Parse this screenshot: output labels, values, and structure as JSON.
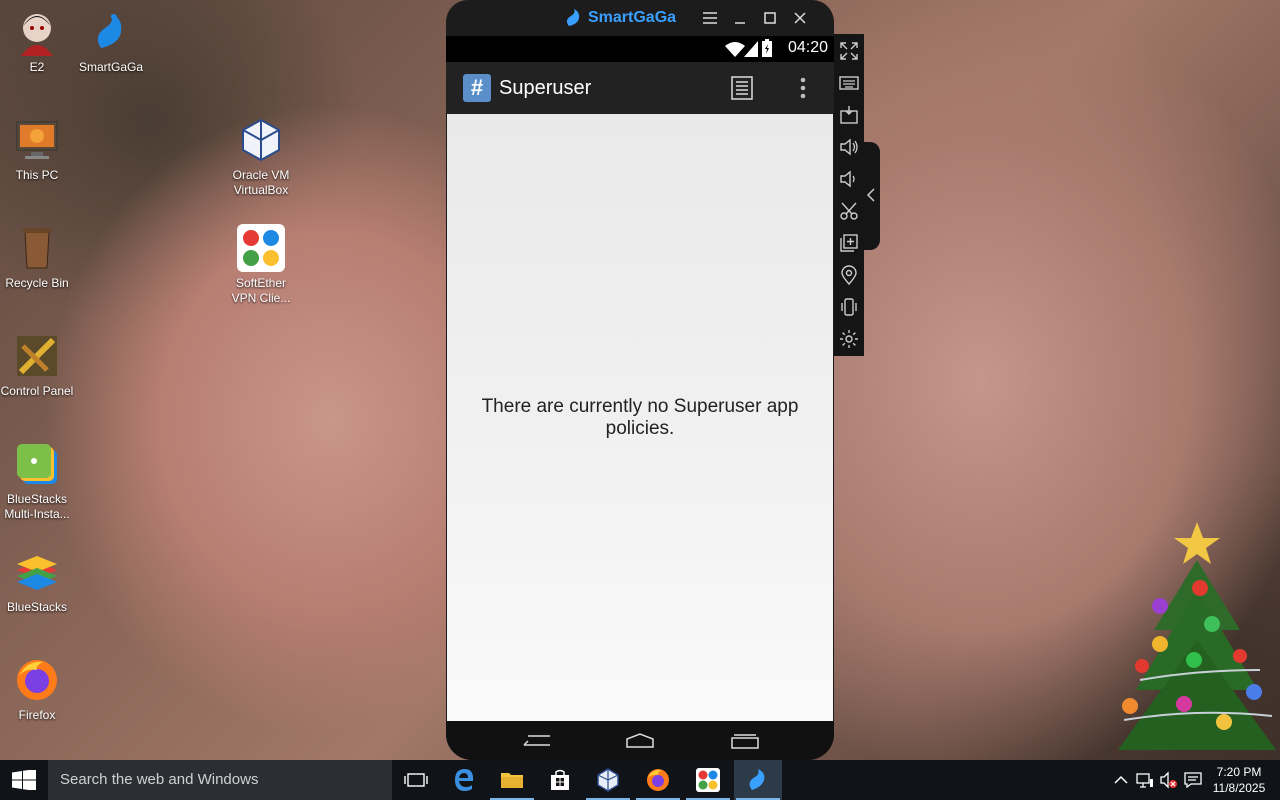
{
  "desktop": {
    "icons": [
      {
        "label": "E2"
      },
      {
        "label": "SmartGaGa"
      },
      {
        "label": "This PC"
      },
      {
        "label": "Oracle VM VirtualBox"
      },
      {
        "label": "Recycle Bin"
      },
      {
        "label": "SoftEther VPN Clie..."
      },
      {
        "label": "Control Panel"
      },
      {
        "label": "BlueStacks Multi-Insta..."
      },
      {
        "label": "BlueStacks"
      },
      {
        "label": "Firefox"
      }
    ]
  },
  "emulator": {
    "brand": "SmartGaGa",
    "window_controls": [
      "menu-icon",
      "minimize-icon",
      "maximize-icon",
      "close-icon"
    ],
    "status_bar": {
      "time": "04:20"
    },
    "app_bar": {
      "title": "Superuser",
      "icon": "hash-icon"
    },
    "screen": {
      "message": "There are currently no Superuser app policies."
    },
    "side_toolbar": [
      "fullscreen-icon",
      "keyboard-icon",
      "apk-install-icon",
      "volume-up-icon",
      "volume-down-icon",
      "screenshot-icon",
      "multi-instance-icon",
      "location-icon",
      "shake-icon",
      "settings-icon"
    ]
  },
  "taskbar": {
    "search_placeholder": "Search the web and Windows",
    "apps": [
      "task-view-icon",
      "edge-icon",
      "file-explorer-icon",
      "store-icon",
      "virtualbox-icon",
      "firefox-icon",
      "softether-icon",
      "smartgaga-icon"
    ],
    "clock": {
      "time": "7:20 PM",
      "date": "11/8/2025"
    }
  },
  "colors": {
    "accent": "#3aa0ff",
    "taskbar": "#101418",
    "app_bar": "#222222"
  }
}
